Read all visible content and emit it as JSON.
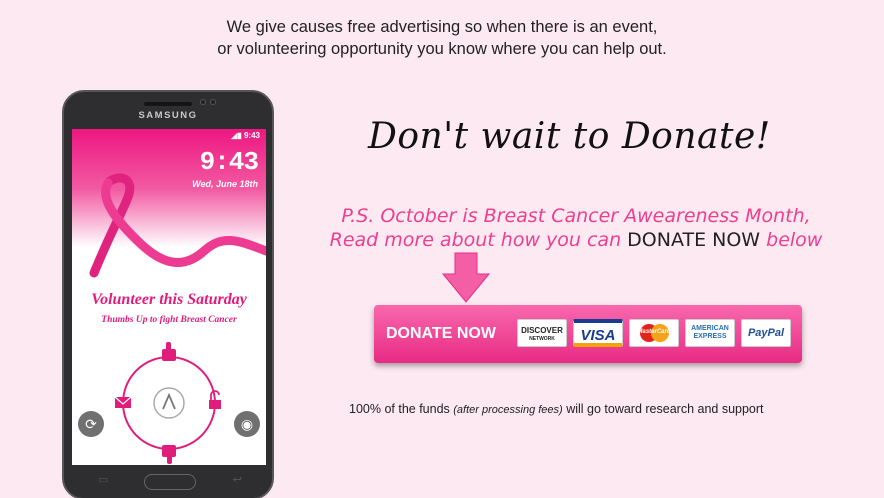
{
  "intro": {
    "line1": "We give causes free advertising so when there is an event,",
    "line2": "or volunteering opportunity you know where you can help out."
  },
  "phone": {
    "brand": "SAMSUNG",
    "status_time": "9:43",
    "clock": "9:43",
    "date": "Wed, June 18th",
    "headline": "Volunteer this Saturday",
    "subline": "Thumbs Up to fight Breast Cancer"
  },
  "headline": "Don't wait to Donate!",
  "ps": {
    "line1": "P.S. October is Breast Cancer Aweareness Month,",
    "line2_before": "Read more about how you can",
    "line2_emph": "DONATE NOW",
    "line2_after": "below"
  },
  "donate": {
    "label": "DONATE NOW",
    "cards": [
      {
        "name": "DISCOVER",
        "sub": "NETWORK"
      },
      {
        "name": "VISA"
      },
      {
        "name": "MasterCard"
      },
      {
        "name": "AMERICAN",
        "sub": "EXPRESS"
      },
      {
        "name": "PayPal"
      }
    ]
  },
  "funds": {
    "before": "100% of the funds",
    "italic": "(after processing fees)",
    "after": "will go toward research and support"
  },
  "colors": {
    "accent": "#e82b84",
    "page_bg": "#fce9f1"
  }
}
